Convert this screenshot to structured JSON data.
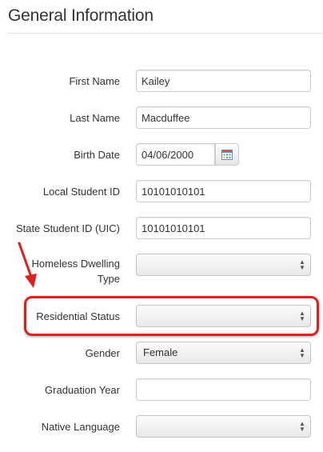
{
  "section": {
    "title": "General Information"
  },
  "fields": {
    "first_name": {
      "label": "First Name",
      "value": "Kailey"
    },
    "last_name": {
      "label": "Last Name",
      "value": "Macduffee"
    },
    "birth_date": {
      "label": "Birth Date",
      "value": "04/06/2000"
    },
    "local_student_id": {
      "label": "Local Student ID",
      "value": "10101010101"
    },
    "state_student_id": {
      "label": "State Student ID (UIC)",
      "value": "10101010101"
    },
    "homeless_dwelling_type": {
      "label": "Homeless Dwelling Type",
      "value": ""
    },
    "residential_status": {
      "label": "Residential Status",
      "value": ""
    },
    "gender": {
      "label": "Gender",
      "value": "Female"
    },
    "graduation_year": {
      "label": "Graduation Year",
      "value": ""
    },
    "native_language": {
      "label": "Native Language",
      "value": ""
    }
  },
  "icons": {
    "calendar": "calendar-icon",
    "select_arrows": "updown-arrows-icon"
  },
  "colors": {
    "highlight": "#e0201c",
    "text": "#333333",
    "border": "#cccccc"
  }
}
